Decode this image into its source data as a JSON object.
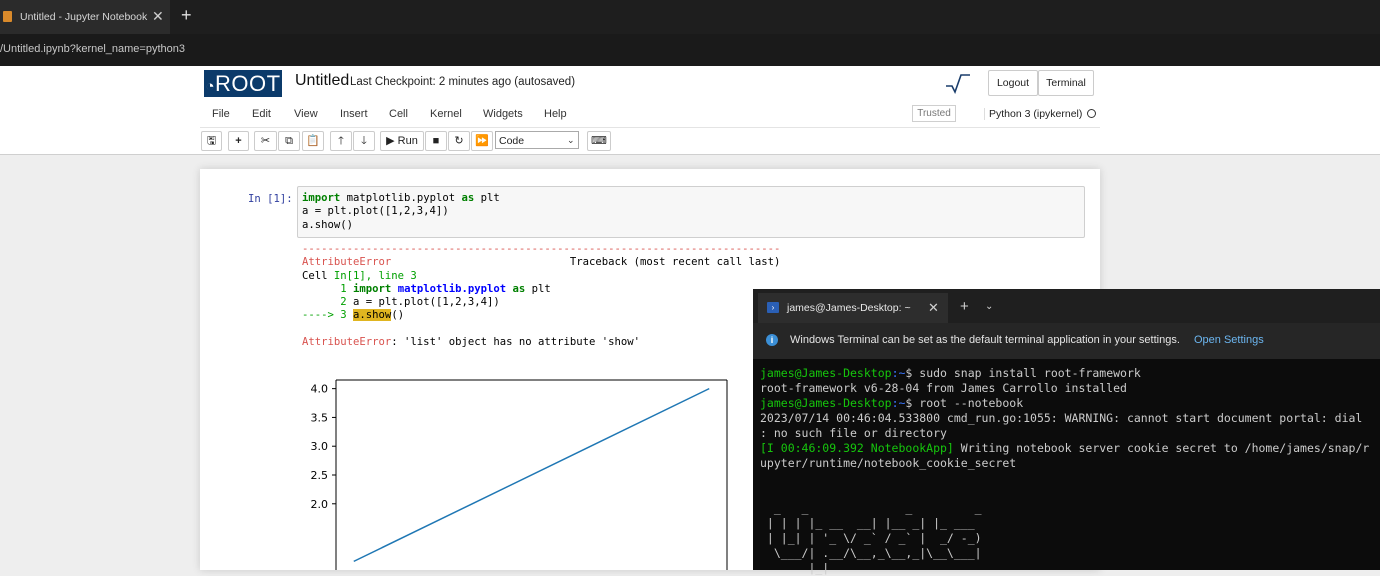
{
  "browser": {
    "tab_title": "Untitled - Jupyter Notebook",
    "tab_close": "✕",
    "new_tab": "+",
    "address": "/Untitled.ipynb?kernel_name=python3"
  },
  "header": {
    "logo_text": "ROOT",
    "notebook_title": "Untitled",
    "checkpoint": "Last Checkpoint: 2 minutes ago  (autosaved)",
    "logout_label": "Logout",
    "terminal_label": "Terminal"
  },
  "menubar": {
    "items": [
      "File",
      "Edit",
      "View",
      "Insert",
      "Cell",
      "Kernel",
      "Widgets",
      "Help"
    ],
    "trusted": "Trusted",
    "kernel_name": "Python 3 (ipykernel)"
  },
  "toolbar": {
    "run_label": "Run",
    "cell_type": "Code"
  },
  "cell": {
    "prompt": "In [1]:",
    "code_lines": [
      {
        "kw": "import",
        "rest": " matplotlib.pyplot ",
        "kw2": "as",
        "rest2": " plt"
      },
      {
        "text": "a = plt.plot([1,2,3,4])"
      },
      {
        "text": "a.show()"
      }
    ]
  },
  "traceback": {
    "dashes": "---------------------------------------------------------------------------",
    "error_name": "AttributeError",
    "traceback_label": "Traceback (most recent call last)",
    "cell_prefix": "Cell ",
    "cell_ref": "In[1], line 3",
    "line1_num": "      1 ",
    "line1_kw": "import",
    "line1_mod": "matplotlib.pyplot",
    "line1_as": "as",
    "line1_rest": " plt",
    "line2_num": "      2 ",
    "line2_text": "a = plt.plot([1,2,3,4])",
    "line3_arrow": "----> 3 ",
    "line3_hl": "a.show",
    "line3_rest": "()",
    "error_msg": ": 'list' object has no attribute 'show'"
  },
  "chart_data": {
    "type": "line",
    "x": [
      0,
      1,
      2,
      3
    ],
    "series": [
      {
        "values": [
          1,
          2,
          3,
          4
        ],
        "color": "#1f77b4"
      }
    ],
    "yticks": [
      "4.0",
      "3.5",
      "3.0",
      "2.5",
      "2.0"
    ],
    "ylim": [
      0.85,
      4.15
    ]
  },
  "terminal": {
    "tab_title": "james@James-Desktop: ~",
    "info_text": "Windows Terminal can be set as the default terminal application in your settings.",
    "open_settings": "Open Settings",
    "lines": [
      {
        "prompt_user": "james@James-Desktop",
        "prompt_path": ":~",
        "cmd": "$ sudo snap install root-framework"
      },
      {
        "text": "root-framework v6-28-04 from James Carrollo installed"
      },
      {
        "prompt_user": "james@James-Desktop",
        "prompt_path": ":~",
        "cmd": "$ root --notebook"
      },
      {
        "text": "2023/07/14 00:46:04.533800 cmd_run.go:1055: WARNING: cannot start document portal: dial"
      },
      {
        "text": ": no such file or directory"
      },
      {
        "green": "[I 00:46:09.392 NotebookApp]",
        "text": " Writing notebook server cookie secret to /home/james/snap/r"
      },
      {
        "text": "upyter/runtime/notebook_cookie_secret"
      },
      {
        "text": ""
      },
      {
        "text": ""
      },
      {
        "text": "  _   _              _         _"
      },
      {
        "text": " | | | |_ __  __| |__ _| |_ ___"
      },
      {
        "text": " | |_| | '_ \\/ _` / _` |  _/ -_)"
      },
      {
        "text": "  \\___/| .__/\\__,_\\__,_|\\__\\___|"
      },
      {
        "text": "       |_|"
      }
    ]
  }
}
